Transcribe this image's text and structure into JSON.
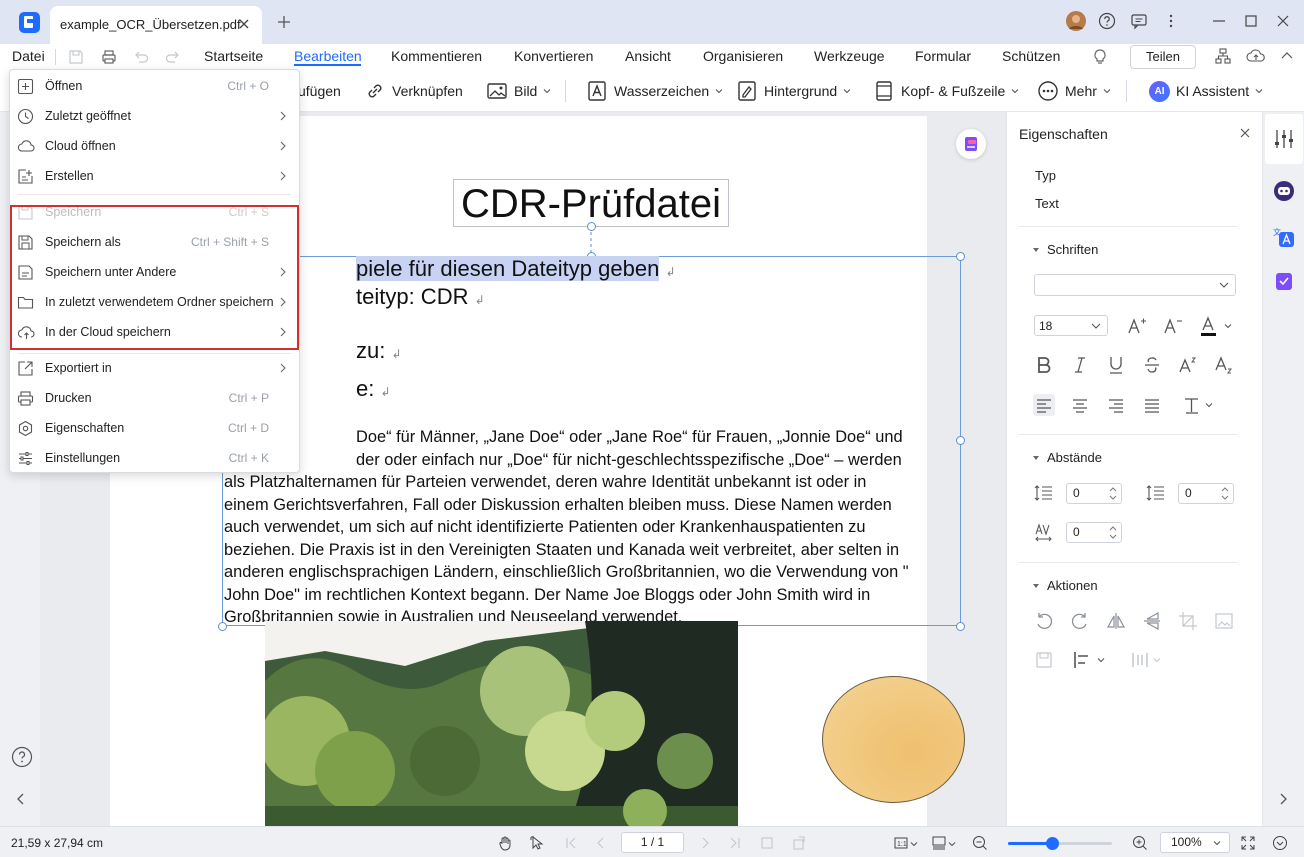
{
  "window": {
    "tab_title": "example_OCR_Übersetzen.pdf"
  },
  "menubar": {
    "file_label": "Datei",
    "items": [
      "Startseite",
      "Bearbeiten",
      "Kommentieren",
      "Konvertieren",
      "Ansicht",
      "Organisieren",
      "Werkzeuge",
      "Formular",
      "Schützen"
    ],
    "active": "Bearbeiten",
    "share_label": "Teilen"
  },
  "toolbar": {
    "items": [
      {
        "label": "ufügen",
        "icon": "add-icon"
      },
      {
        "label": "Verknüpfen",
        "icon": "link-icon"
      },
      {
        "label": "Bild",
        "icon": "image-icon"
      },
      {
        "label": "Wasserzeichen",
        "icon": "watermark-icon"
      },
      {
        "label": "Hintergrund",
        "icon": "background-icon"
      },
      {
        "label": "Kopf- & Fußzeile",
        "icon": "header-footer-icon"
      },
      {
        "label": "Mehr",
        "icon": "more-icon"
      },
      {
        "label": "KI Assistent",
        "icon": "ai-icon"
      }
    ],
    "ai_badge": "AI"
  },
  "file_menu": {
    "items": [
      {
        "label": "Öffnen",
        "shortcut": "Ctrl + O",
        "submenu": false,
        "disabled": false,
        "icon": "open-icon"
      },
      {
        "label": "Zuletzt geöffnet",
        "shortcut": "",
        "submenu": true,
        "disabled": false,
        "icon": "recent-icon"
      },
      {
        "label": "Cloud öffnen",
        "shortcut": "",
        "submenu": true,
        "disabled": false,
        "icon": "cloud-icon"
      },
      {
        "label": "Erstellen",
        "shortcut": "",
        "submenu": true,
        "disabled": false,
        "icon": "create-icon"
      },
      {
        "label": "Speichern",
        "shortcut": "Ctrl + S",
        "submenu": false,
        "disabled": true,
        "icon": "save-icon"
      },
      {
        "label": "Speichern als",
        "shortcut": "Ctrl + Shift + S",
        "submenu": false,
        "disabled": false,
        "icon": "save-as-icon"
      },
      {
        "label": "Speichern unter Andere",
        "shortcut": "",
        "submenu": true,
        "disabled": false,
        "icon": "save-other-icon"
      },
      {
        "label": "In zuletzt verwendetem Ordner speichern",
        "shortcut": "",
        "submenu": true,
        "disabled": false,
        "icon": "folder-icon"
      },
      {
        "label": "In der Cloud speichern",
        "shortcut": "",
        "submenu": true,
        "disabled": false,
        "icon": "cloud-upload-icon"
      },
      {
        "label": "Exportiert in",
        "shortcut": "",
        "submenu": true,
        "disabled": false,
        "icon": "export-icon"
      },
      {
        "label": "Drucken",
        "shortcut": "Ctrl + P",
        "submenu": false,
        "disabled": false,
        "icon": "print-icon"
      },
      {
        "label": "Eigenschaften",
        "shortcut": "Ctrl + D",
        "submenu": false,
        "disabled": false,
        "icon": "properties-icon"
      },
      {
        "label": "Einstellungen",
        "shortcut": "Ctrl + K",
        "submenu": false,
        "disabled": false,
        "icon": "settings-icon"
      }
    ]
  },
  "document": {
    "title": "CDR-Prüfdatei",
    "line1": "piele für diesen Dateityp geben",
    "line2": "teityp: CDR",
    "line3": "zu:",
    "line4": "e:",
    "paragraph": [
      "Doe“ für Männer, „Jane Doe“ oder „Jane Roe“ für Frauen, „Jonnie Doe“ und",
      "der oder einfach nur „Doe“ für nicht-geschlechtsspezifische „Doe“ – werden",
      "als Platzhalternamen für Parteien verwendet, deren wahre Identität unbekannt ist oder in",
      "einem Gerichtsverfahren, Fall oder Diskussion erhalten bleiben muss. Diese Namen werden",
      "auch verwendet, um sich auf nicht identifizierte Patienten oder Krankenhauspatienten zu",
      "beziehen. Die Praxis ist in den Vereinigten Staaten und Kanada weit verbreitet, aber selten in",
      "anderen englischsprachigen Ländern, einschließlich Großbritannien, wo die Verwendung von \"",
      "John Doe\" im rechtlichen Kontext begann. Der Name Joe Bloggs oder John Smith wird in",
      "Großbritannien sowie in Australien und Neuseeland verwendet."
    ],
    "return_mark": "↲"
  },
  "properties": {
    "title": "Eigenschaften",
    "type_label": "Typ",
    "type_value": "Text",
    "fonts_section": "Schriften",
    "font_family": "",
    "font_size": "18",
    "spacing_section": "Abstände",
    "line_spacing": "0",
    "paragraph_spacing": "0",
    "char_spacing": "0",
    "actions_section": "Aktionen"
  },
  "status": {
    "page_size": "21,59 x 27,94 cm",
    "page_indicator": "1 / 1",
    "zoom": "100%",
    "zoom_fraction": 0.42
  },
  "colors": {
    "accent": "#1e6bff",
    "highlight": "#c8d3f4",
    "red_outline": "#d32f2f",
    "ellipse_fill": "#f2cb84"
  }
}
